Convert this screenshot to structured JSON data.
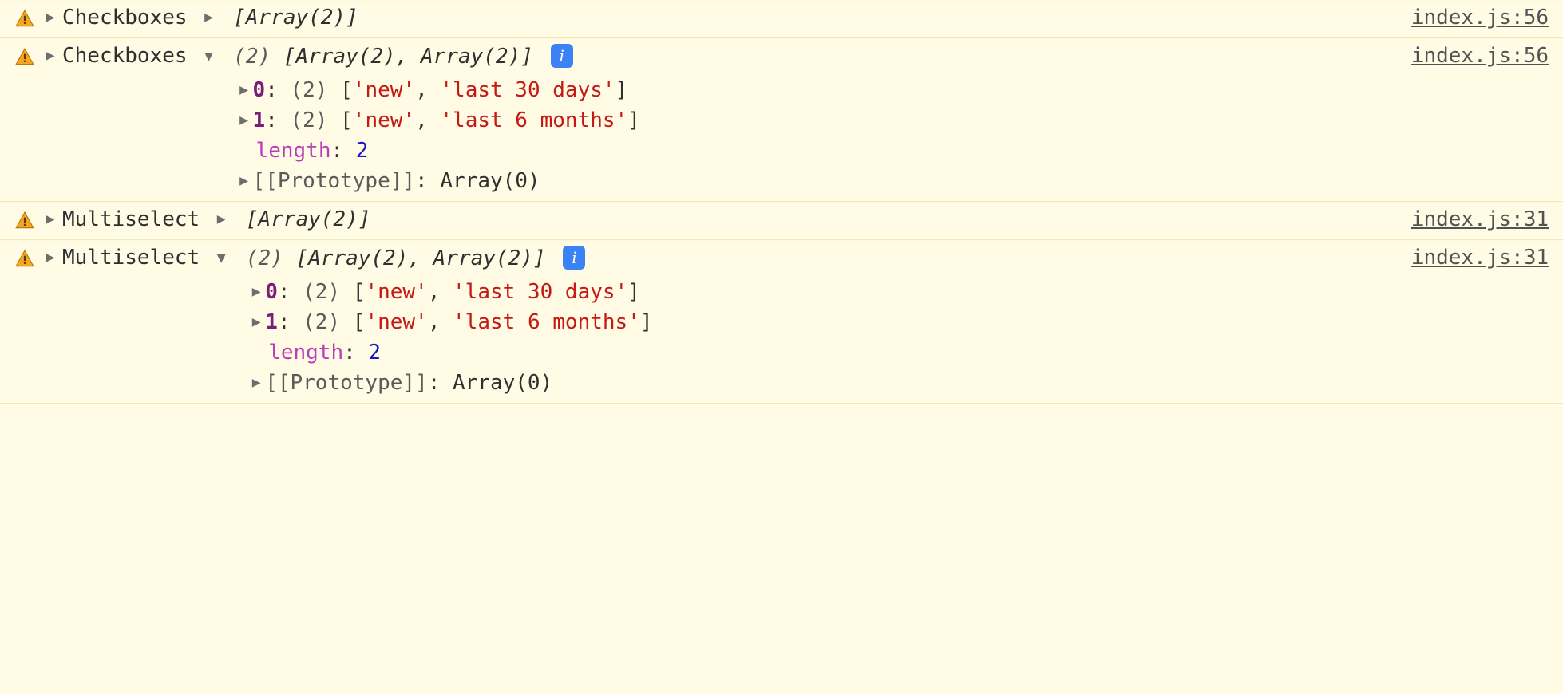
{
  "info_glyph": "i",
  "rows": [
    {
      "kind": "collapsed",
      "label": "Checkboxes",
      "summary": "[Array(2)]",
      "source": "index.js:56"
    },
    {
      "kind": "expanded",
      "label": "Checkboxes",
      "summary_count": "(2)",
      "summary_body": "[Array(2), Array(2)]",
      "source": "index.js:56",
      "items": [
        {
          "index": "0",
          "count": "(2)",
          "vals": [
            "'new'",
            "'last 30 days'"
          ]
        },
        {
          "index": "1",
          "count": "(2)",
          "vals": [
            "'new'",
            "'last 6 months'"
          ]
        }
      ],
      "length_key": "length",
      "length_val": "2",
      "proto_label": "[[Prototype]]",
      "proto_val": "Array(0)"
    },
    {
      "kind": "collapsed",
      "label": "Multiselect",
      "summary": "[Array(2)]",
      "source": "index.js:31"
    },
    {
      "kind": "expanded",
      "label": "Multiselect",
      "summary_count": "(2)",
      "summary_body": "[Array(2), Array(2)]",
      "source": "index.js:31",
      "items": [
        {
          "index": "0",
          "count": "(2)",
          "vals": [
            "'new'",
            "'last 30 days'"
          ]
        },
        {
          "index": "1",
          "count": "(2)",
          "vals": [
            "'new'",
            "'last 6 months'"
          ]
        }
      ],
      "length_key": "length",
      "length_val": "2",
      "proto_label": "[[Prototype]]",
      "proto_val": "Array(0)"
    }
  ]
}
